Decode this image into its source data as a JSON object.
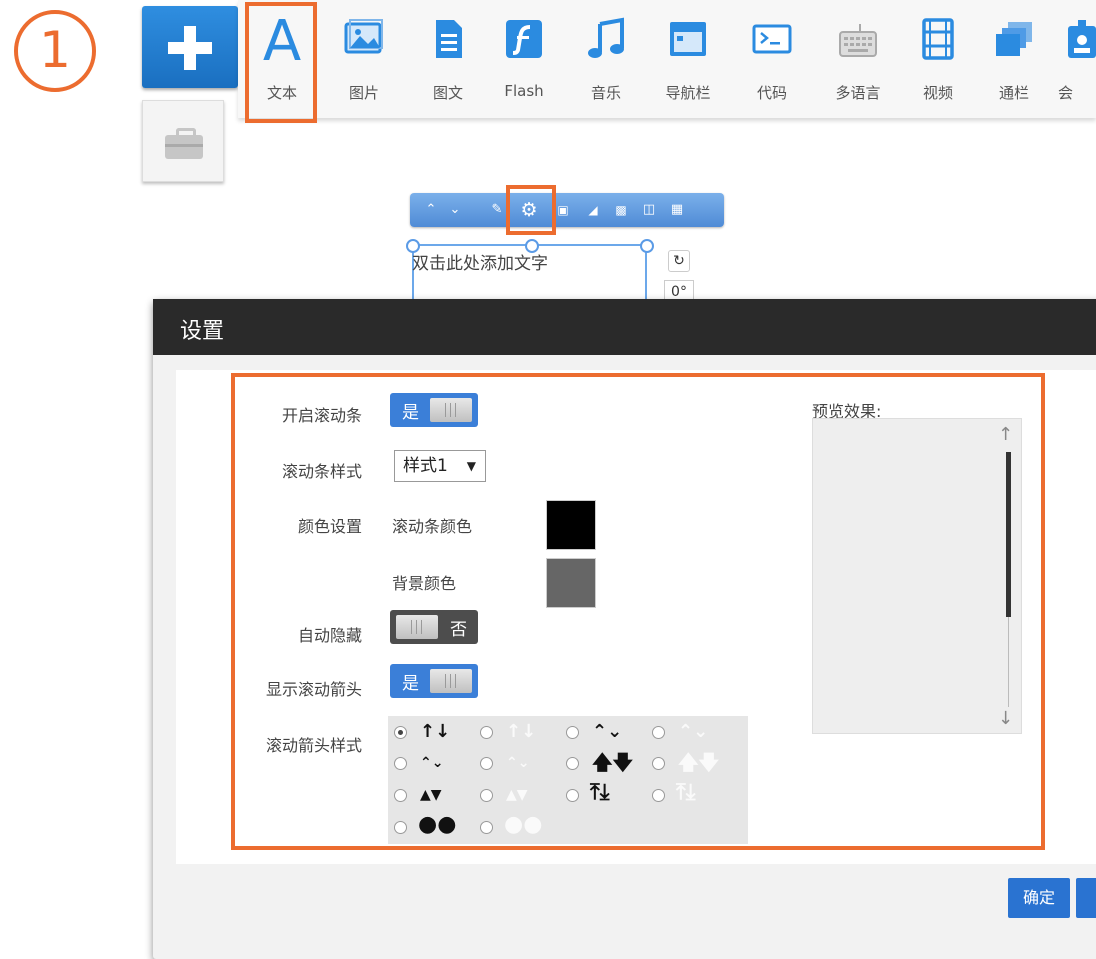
{
  "step_number": "1",
  "toolbar": {
    "items": [
      {
        "label": "文本",
        "icon": "text-icon"
      },
      {
        "label": "图片",
        "icon": "image-icon"
      },
      {
        "label": "图文",
        "icon": "document-icon"
      },
      {
        "label": "Flash",
        "icon": "flash-icon"
      },
      {
        "label": "音乐",
        "icon": "music-icon"
      },
      {
        "label": "导航栏",
        "icon": "navbar-icon"
      },
      {
        "label": "代码",
        "icon": "code-icon"
      },
      {
        "label": "多语言",
        "icon": "keyboard-icon"
      },
      {
        "label": "视频",
        "icon": "video-icon"
      },
      {
        "label": "通栏",
        "icon": "layers-icon"
      },
      {
        "label": "会",
        "icon": "member-icon"
      }
    ]
  },
  "canvas": {
    "text_placeholder": "双击此处添加文字",
    "angle": "0°"
  },
  "dialog": {
    "title": "设置",
    "fields": {
      "enable_scrollbar": {
        "label": "开启滚动条",
        "value": "是"
      },
      "scrollbar_style": {
        "label": "滚动条样式",
        "value": "样式1"
      },
      "color_settings": {
        "label": "颜色设置",
        "scrollbar_color_label": "滚动条颜色",
        "scrollbar_color": "#000000",
        "bg_color_label": "背景颜色",
        "bg_color": "#666666"
      },
      "auto_hide": {
        "label": "自动隐藏",
        "value": "否"
      },
      "show_arrows": {
        "label": "显示滚动箭头",
        "value": "是"
      },
      "arrow_style": {
        "label": "滚动箭头样式"
      }
    },
    "preview_label": "预览效果:",
    "confirm_label": "确定"
  },
  "colors": {
    "accent": "#2b8be0",
    "highlight": "#ec6c2f",
    "dialog_header": "#2a2a2a"
  }
}
